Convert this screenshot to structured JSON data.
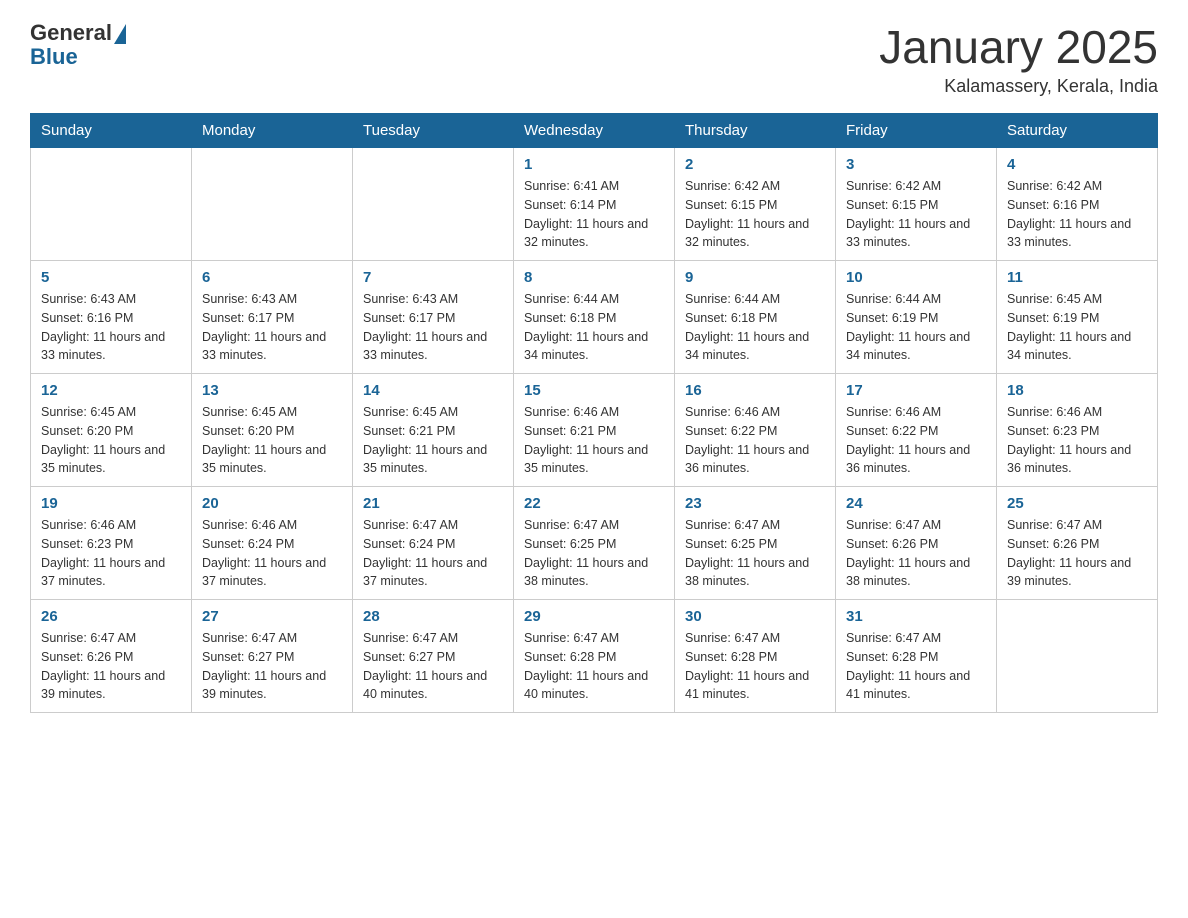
{
  "logo": {
    "general": "General",
    "blue": "Blue"
  },
  "title": "January 2025",
  "location": "Kalamassery, Kerala, India",
  "days_of_week": [
    "Sunday",
    "Monday",
    "Tuesday",
    "Wednesday",
    "Thursday",
    "Friday",
    "Saturday"
  ],
  "weeks": [
    [
      {
        "day": "",
        "info": ""
      },
      {
        "day": "",
        "info": ""
      },
      {
        "day": "",
        "info": ""
      },
      {
        "day": "1",
        "info": "Sunrise: 6:41 AM\nSunset: 6:14 PM\nDaylight: 11 hours and 32 minutes."
      },
      {
        "day": "2",
        "info": "Sunrise: 6:42 AM\nSunset: 6:15 PM\nDaylight: 11 hours and 32 minutes."
      },
      {
        "day": "3",
        "info": "Sunrise: 6:42 AM\nSunset: 6:15 PM\nDaylight: 11 hours and 33 minutes."
      },
      {
        "day": "4",
        "info": "Sunrise: 6:42 AM\nSunset: 6:16 PM\nDaylight: 11 hours and 33 minutes."
      }
    ],
    [
      {
        "day": "5",
        "info": "Sunrise: 6:43 AM\nSunset: 6:16 PM\nDaylight: 11 hours and 33 minutes."
      },
      {
        "day": "6",
        "info": "Sunrise: 6:43 AM\nSunset: 6:17 PM\nDaylight: 11 hours and 33 minutes."
      },
      {
        "day": "7",
        "info": "Sunrise: 6:43 AM\nSunset: 6:17 PM\nDaylight: 11 hours and 33 minutes."
      },
      {
        "day": "8",
        "info": "Sunrise: 6:44 AM\nSunset: 6:18 PM\nDaylight: 11 hours and 34 minutes."
      },
      {
        "day": "9",
        "info": "Sunrise: 6:44 AM\nSunset: 6:18 PM\nDaylight: 11 hours and 34 minutes."
      },
      {
        "day": "10",
        "info": "Sunrise: 6:44 AM\nSunset: 6:19 PM\nDaylight: 11 hours and 34 minutes."
      },
      {
        "day": "11",
        "info": "Sunrise: 6:45 AM\nSunset: 6:19 PM\nDaylight: 11 hours and 34 minutes."
      }
    ],
    [
      {
        "day": "12",
        "info": "Sunrise: 6:45 AM\nSunset: 6:20 PM\nDaylight: 11 hours and 35 minutes."
      },
      {
        "day": "13",
        "info": "Sunrise: 6:45 AM\nSunset: 6:20 PM\nDaylight: 11 hours and 35 minutes."
      },
      {
        "day": "14",
        "info": "Sunrise: 6:45 AM\nSunset: 6:21 PM\nDaylight: 11 hours and 35 minutes."
      },
      {
        "day": "15",
        "info": "Sunrise: 6:46 AM\nSunset: 6:21 PM\nDaylight: 11 hours and 35 minutes."
      },
      {
        "day": "16",
        "info": "Sunrise: 6:46 AM\nSunset: 6:22 PM\nDaylight: 11 hours and 36 minutes."
      },
      {
        "day": "17",
        "info": "Sunrise: 6:46 AM\nSunset: 6:22 PM\nDaylight: 11 hours and 36 minutes."
      },
      {
        "day": "18",
        "info": "Sunrise: 6:46 AM\nSunset: 6:23 PM\nDaylight: 11 hours and 36 minutes."
      }
    ],
    [
      {
        "day": "19",
        "info": "Sunrise: 6:46 AM\nSunset: 6:23 PM\nDaylight: 11 hours and 37 minutes."
      },
      {
        "day": "20",
        "info": "Sunrise: 6:46 AM\nSunset: 6:24 PM\nDaylight: 11 hours and 37 minutes."
      },
      {
        "day": "21",
        "info": "Sunrise: 6:47 AM\nSunset: 6:24 PM\nDaylight: 11 hours and 37 minutes."
      },
      {
        "day": "22",
        "info": "Sunrise: 6:47 AM\nSunset: 6:25 PM\nDaylight: 11 hours and 38 minutes."
      },
      {
        "day": "23",
        "info": "Sunrise: 6:47 AM\nSunset: 6:25 PM\nDaylight: 11 hours and 38 minutes."
      },
      {
        "day": "24",
        "info": "Sunrise: 6:47 AM\nSunset: 6:26 PM\nDaylight: 11 hours and 38 minutes."
      },
      {
        "day": "25",
        "info": "Sunrise: 6:47 AM\nSunset: 6:26 PM\nDaylight: 11 hours and 39 minutes."
      }
    ],
    [
      {
        "day": "26",
        "info": "Sunrise: 6:47 AM\nSunset: 6:26 PM\nDaylight: 11 hours and 39 minutes."
      },
      {
        "day": "27",
        "info": "Sunrise: 6:47 AM\nSunset: 6:27 PM\nDaylight: 11 hours and 39 minutes."
      },
      {
        "day": "28",
        "info": "Sunrise: 6:47 AM\nSunset: 6:27 PM\nDaylight: 11 hours and 40 minutes."
      },
      {
        "day": "29",
        "info": "Sunrise: 6:47 AM\nSunset: 6:28 PM\nDaylight: 11 hours and 40 minutes."
      },
      {
        "day": "30",
        "info": "Sunrise: 6:47 AM\nSunset: 6:28 PM\nDaylight: 11 hours and 41 minutes."
      },
      {
        "day": "31",
        "info": "Sunrise: 6:47 AM\nSunset: 6:28 PM\nDaylight: 11 hours and 41 minutes."
      },
      {
        "day": "",
        "info": ""
      }
    ]
  ]
}
